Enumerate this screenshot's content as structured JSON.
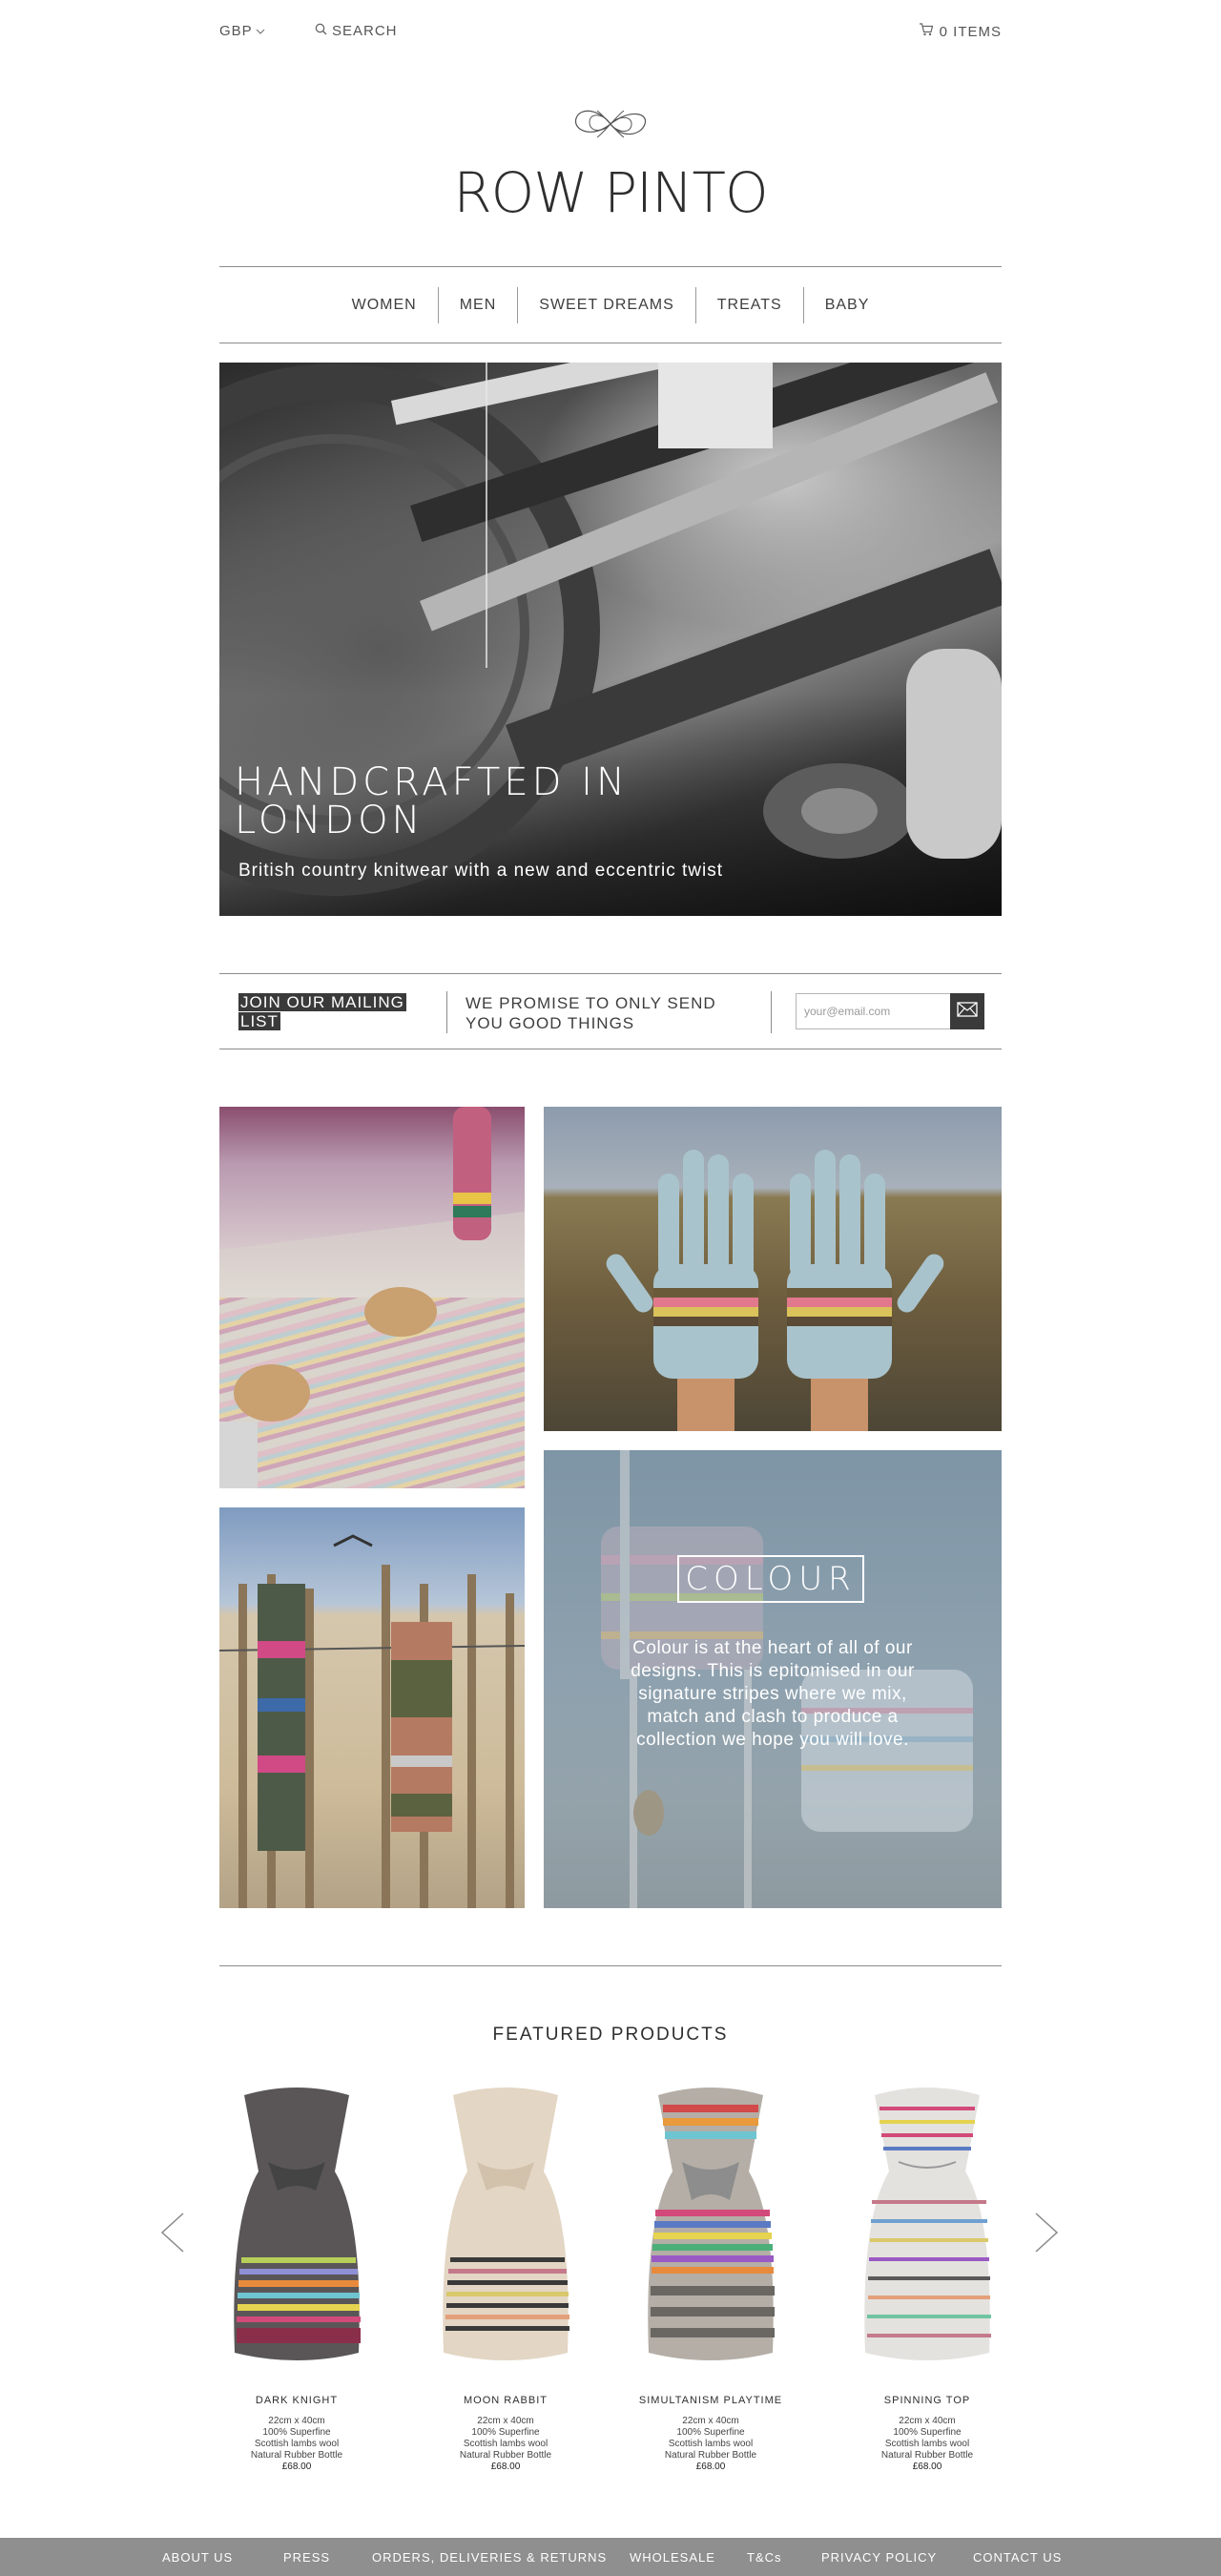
{
  "topbar": {
    "currency": "GBP",
    "search_label": "SEARCH",
    "cart_label": "0 ITEMS",
    "icons": {
      "currency_caret": "chevron-down-icon",
      "search": "search-icon",
      "cart": "cart-icon"
    }
  },
  "brand": {
    "name": "ROW PINTO",
    "logo_icon": "knot-logo-icon"
  },
  "nav": {
    "items": [
      {
        "label": "WOMEN"
      },
      {
        "label": "MEN"
      },
      {
        "label": "SWEET DREAMS"
      },
      {
        "label": "TREATS"
      },
      {
        "label": "BABY"
      }
    ]
  },
  "hero": {
    "title": "HANDCRAFTED IN LONDON",
    "subtitle": "British country knitwear with a new and eccentric twist"
  },
  "mailing": {
    "join_label": "JOIN OUR MAILING LIST",
    "promise": "WE PROMISE TO ONLY SEND YOU GOOD THINGS",
    "email_placeholder": "your@email.com",
    "submit_icon": "envelope-icon"
  },
  "colour_panel": {
    "heading": "COLOUR",
    "text": "Colour is at the heart of all of our designs. This is epitomised in our signature stripes where we mix, match and clash to produce a collection we hope you will love."
  },
  "featured": {
    "title": "FEATURED PRODUCTS",
    "prev_icon": "chevron-left-icon",
    "next_icon": "chevron-right-icon",
    "products": [
      {
        "name": "DARK KNIGHT",
        "spec1": "22cm x 40cm",
        "spec2": "100% Superfine",
        "spec3": "Scottish lambs wool",
        "spec4": "Natural Rubber Bottle",
        "price": "£68.00",
        "base_color": "#5a5658"
      },
      {
        "name": "MOON RABBIT",
        "spec1": "22cm x 40cm",
        "spec2": "100% Superfine",
        "spec3": "Scottish lambs wool",
        "spec4": "Natural Rubber Bottle",
        "price": "£68.00",
        "base_color": "#e3d6c4"
      },
      {
        "name": "SIMULTANISM PLAYTIME",
        "spec1": "22cm x 40cm",
        "spec2": "100% Superfine",
        "spec3": "Scottish lambs wool",
        "spec4": "Natural Rubber Bottle",
        "price": "£68.00",
        "base_color": "#b4aea6"
      },
      {
        "name": "SPINNING TOP",
        "spec1": "22cm x 40cm",
        "spec2": "100% Superfine",
        "spec3": "Scottish lambs wool",
        "spec4": "Natural Rubber Bottle",
        "price": "£68.00",
        "base_color": "#e4e2de"
      }
    ]
  },
  "footer": {
    "links": [
      {
        "label": "ABOUT US"
      },
      {
        "label": "PRESS"
      },
      {
        "label": "ORDERS, DELIVERIES & RETURNS"
      },
      {
        "label": "WHOLESALE"
      },
      {
        "label": "T&Cs"
      },
      {
        "label": "PRIVACY POLICY"
      },
      {
        "label": "CONTACT US"
      }
    ]
  }
}
